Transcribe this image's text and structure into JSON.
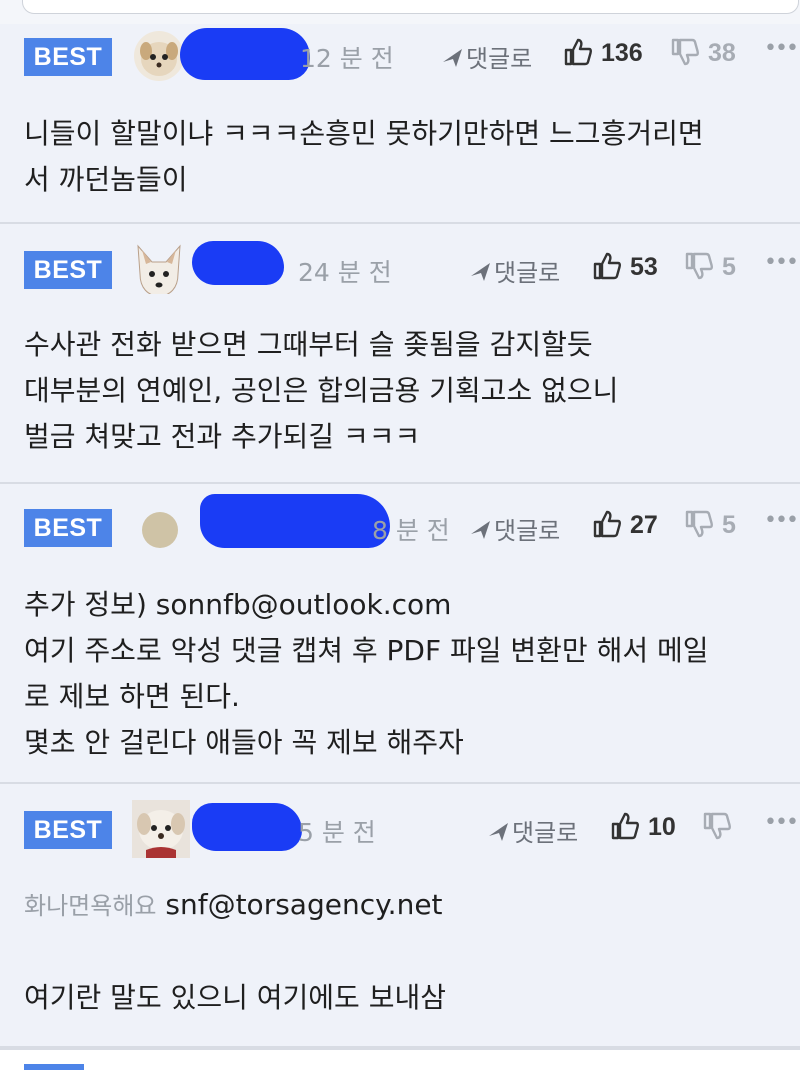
{
  "comments": [
    {
      "badge": "BEST",
      "time": "12 분 전",
      "reply_label": "댓글로",
      "likes": "136",
      "dislikes": "38",
      "lines": [
        "니들이 할말이냐 ㅋㅋㅋ손흥민 못하기만하면 느그흥거리면",
        "서 까던놈들이"
      ]
    },
    {
      "badge": "BEST",
      "time": "24 분 전",
      "reply_label": "댓글로",
      "likes": "53",
      "dislikes": "5",
      "lines": [
        "수사관 전화 받으면 그때부터 슬 좆됨을 감지할듯",
        "대부분의 연예인, 공인은 합의금용 기획고소 없으니",
        "벌금 쳐맞고 전과 추가되길 ㅋㅋㅋ"
      ]
    },
    {
      "badge": "BEST",
      "time": "8 분 전",
      "reply_label": "댓글로",
      "likes": "27",
      "dislikes": "5",
      "lines": [
        "추가 정보) sonnfb@outlook.com",
        "여기 주소로 악성 댓글 캡쳐 후 PDF 파일 변환만 해서 메일",
        "로 제보 하면 된다.",
        "몇초 안 걸린다 애들아 꼭 제보 해주자"
      ]
    },
    {
      "badge": "BEST",
      "time": "5 분 전",
      "reply_label": "댓글로",
      "likes": "10",
      "dislikes": "",
      "gray_prefix": "화나면욕해요",
      "email": "snf@torsagency.net",
      "lines": [
        "여기란 말도 있으니 여기에도 보내삼"
      ]
    }
  ],
  "more_icon": "ellipsis-icon",
  "colors": {
    "badge": "#4d84e8",
    "redaction": "#1a3cf5",
    "background": "#eff2f9"
  }
}
